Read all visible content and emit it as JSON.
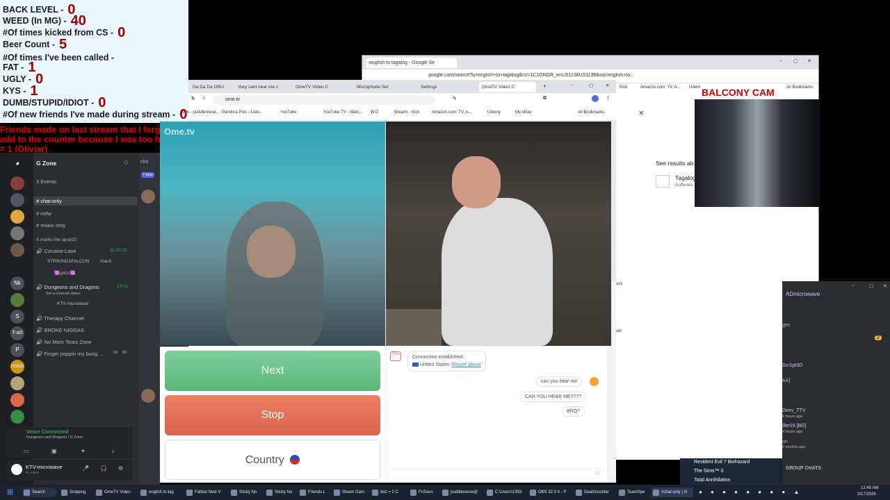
{
  "counter": {
    "lines": [
      {
        "label": "BACK LEVEL -",
        "value": "0"
      },
      {
        "label": "WEED (In MG) -",
        "value": "40"
      },
      {
        "label": "#Of times kicked from CS -",
        "value": "0"
      },
      {
        "label": "Beer Count -",
        "value": "5"
      },
      {
        "label": "#Of times I've been called -",
        "value": ""
      },
      {
        "label": "FAT -",
        "value": "1"
      },
      {
        "label": "UGLY -",
        "value": "0"
      },
      {
        "label": "KYS -",
        "value": "1"
      },
      {
        "label": "DUMB/STUPID/IDIOT -",
        "value": "0"
      },
      {
        "label": "#Of new friends I've made during stream -",
        "value": "0"
      }
    ],
    "friends_note": "Friends made on last stream that I forgot to add to the counter because I was too high = 1 (Oliviar)"
  },
  "discord": {
    "server_name": "G Zone",
    "events": "3 Events",
    "channels": [
      {
        "name": "chat-only",
        "active": true
      },
      {
        "name": "nsfw",
        "active": false
      },
      {
        "name": "music-only",
        "active": false
      }
    ],
    "category": "X marks the spot(G)",
    "voice": [
      {
        "name": "Cocaine Lane",
        "time": "11:20:20",
        "users": [
          "STRIKING1FALCON",
          "mau5",
          "✡️gsizz✡️"
        ]
      },
      {
        "name": "Dungeons and Dragons",
        "time": "23:01",
        "status": "Set a channel status",
        "users": [
          "KTV-microwave"
        ]
      },
      {
        "name": "Therapy Channel"
      },
      {
        "name": "BROKE NIGGAS"
      },
      {
        "name": "No More Tears Zone"
      },
      {
        "name": "Finger poppin my bung ...",
        "badges": [
          "00",
          "99"
        ]
      }
    ],
    "server_labels": [
      "Nk",
      "S",
      "T-aD",
      "P",
      "HOOD"
    ],
    "voice_connected": "Voice Connected",
    "voice_location": "Dungeons and Dragons / G Zone",
    "user_name": "KTV-microwave",
    "user_status": "In voice",
    "right_header": "cha",
    "new_badge": "7 new"
  },
  "chrome_back": {
    "tab_title": "english to tagalog - Google Se",
    "url": "google.com/search?q=english+to+tagalog&rlz=1C1ONGR_enUS1136US1136&oq=english+to...",
    "see_results": "See results ab",
    "result_title": "Tagalog",
    "result_sub": "Software",
    "bookmarks": [
      "Kick",
      "Amazon.com: TV, A...",
      "Udem"
    ],
    "all_bookmarks": "All Bookmarks"
  },
  "balcony": {
    "label": "BALCONY CAM"
  },
  "ome_window": {
    "tabs": [
      {
        "title": "Da Da Da Offici",
        "active": false
      },
      {
        "title": "they cant hear me c",
        "active": false
      },
      {
        "title": "OmeTV Video C",
        "active": false
      },
      {
        "title": "Microphone Set",
        "active": false
      },
      {
        "title": "Settings",
        "active": false
      },
      {
        "title": "OmeTV Video C",
        "active": true
      }
    ],
    "url": "ome.tv",
    "bookmarks": [
      "nbox - puddlereese...",
      "Pandora Plus - Liste...",
      "YouTube",
      "YouTube TV - Watc...",
      "W.D",
      "Streami - Kick",
      "Amazon.com: TV, A...",
      "Udemy",
      "My eBay"
    ],
    "all_bookmarks": "All Bookmarks",
    "logo": "Ome.tv"
  },
  "ome_controls": {
    "next": "Next",
    "stop": "Stop",
    "country": "Country"
  },
  "chat": {
    "system_line1": "Connection established.",
    "system_country": "United States.",
    "report": "Report abuse",
    "messages": [
      "can you hear me",
      "CAN YOU HEAR ME????",
      "BRO?"
    ]
  },
  "right_panel": {
    "labels": [
      "ack",
      "ate"
    ]
  },
  "group_win": {
    "user": "ADmicrowave",
    "labels": [
      "ges",
      "Scr1pt3D",
      "AA]",
      "Deev_TTV",
      "4 hours ago",
      "iller19 [BD]",
      "4 hours ago",
      "on",
      "2 months ago"
    ],
    "badge": "2",
    "footer": "GROUP CHATS"
  },
  "steam_friends": {
    "games": [
      "Resident Evil 7 Biohazard",
      "The Sims™ 3",
      "Total Annihilation"
    ]
  },
  "taskbar": {
    "items": [
      "Search",
      "Snipping",
      "OmeTV Video",
      "english to tag",
      "Fallout New V",
      "Sticky No",
      "Sticky No",
      "Friends L",
      "Steam Gam",
      "doz = 2 C",
      "FxSoun",
      "puddlereese@",
      "C:\\Users\\1303",
      "OBS 32.0.4 - P",
      "Deathcounter",
      "TeamSpe",
      "#chat-only | G"
    ],
    "time": "12:45 AM",
    "date": "2/17/2026"
  },
  "colors": {
    "next": "#5cb77b",
    "stop": "#d9634a",
    "counter_value": "#a00000",
    "note": "#e00000",
    "balcony": "#d00000"
  }
}
